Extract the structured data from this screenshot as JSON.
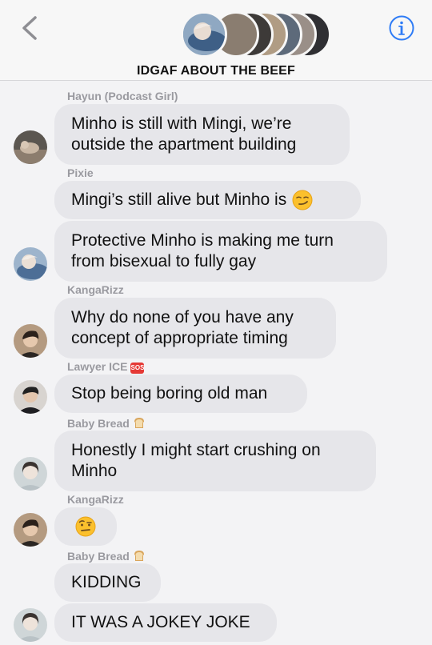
{
  "header": {
    "title": "IDGAF ABOUT THE BEEF",
    "back_icon": "chevron-left-icon",
    "info_icon": "info-circle-icon",
    "stack_colors": [
      "#6e8fb0",
      "#8a7d70",
      "#3d3a38",
      "#b09c84",
      "#5d6a7a",
      "#9a8f88",
      "#2f2f33"
    ]
  },
  "messages": [
    {
      "sender": "Hayun (Podcast Girl)",
      "text": "Minho is still with Mingi, we’re\noutside the apartment building",
      "avatar": "avatar-hayun"
    },
    {
      "sender": "Pixie",
      "text": "Mingi’s still alive but Minho is",
      "emoji": "smirk-emoji-icon"
    },
    {
      "text": "Protective Minho is making me turn\nfrom bisexual to fully gay",
      "avatar": "avatar-pixie"
    },
    {
      "sender": "KangaRizz",
      "text": "Why do none of you have any\nconcept of appropriate timing",
      "avatar": "avatar-kangarizz"
    },
    {
      "sender": "Lawyer ICE",
      "badge": "SOS",
      "text": "Stop being boring old man",
      "avatar": "avatar-lawyer-ice"
    },
    {
      "sender": "Baby Bread",
      "badge_icon": "bread-icon",
      "text": "Honestly I might start crushing on\nMinho",
      "avatar": "avatar-baby-bread"
    },
    {
      "sender": "KangaRizz",
      "emoji_only": "raised-eyebrow-emoji-icon",
      "avatar": "avatar-kangarizz"
    },
    {
      "sender": "Baby Bread",
      "badge_icon": "bread-icon",
      "text": "KIDDING"
    },
    {
      "text": "IT WAS A JOKEY JOKE",
      "avatar": "avatar-baby-bread"
    }
  ],
  "colors": {
    "bubble": "#e6e6ea",
    "sender": "#9a9aa0",
    "accent": "#2f7cf6",
    "sos": "#e53935"
  }
}
